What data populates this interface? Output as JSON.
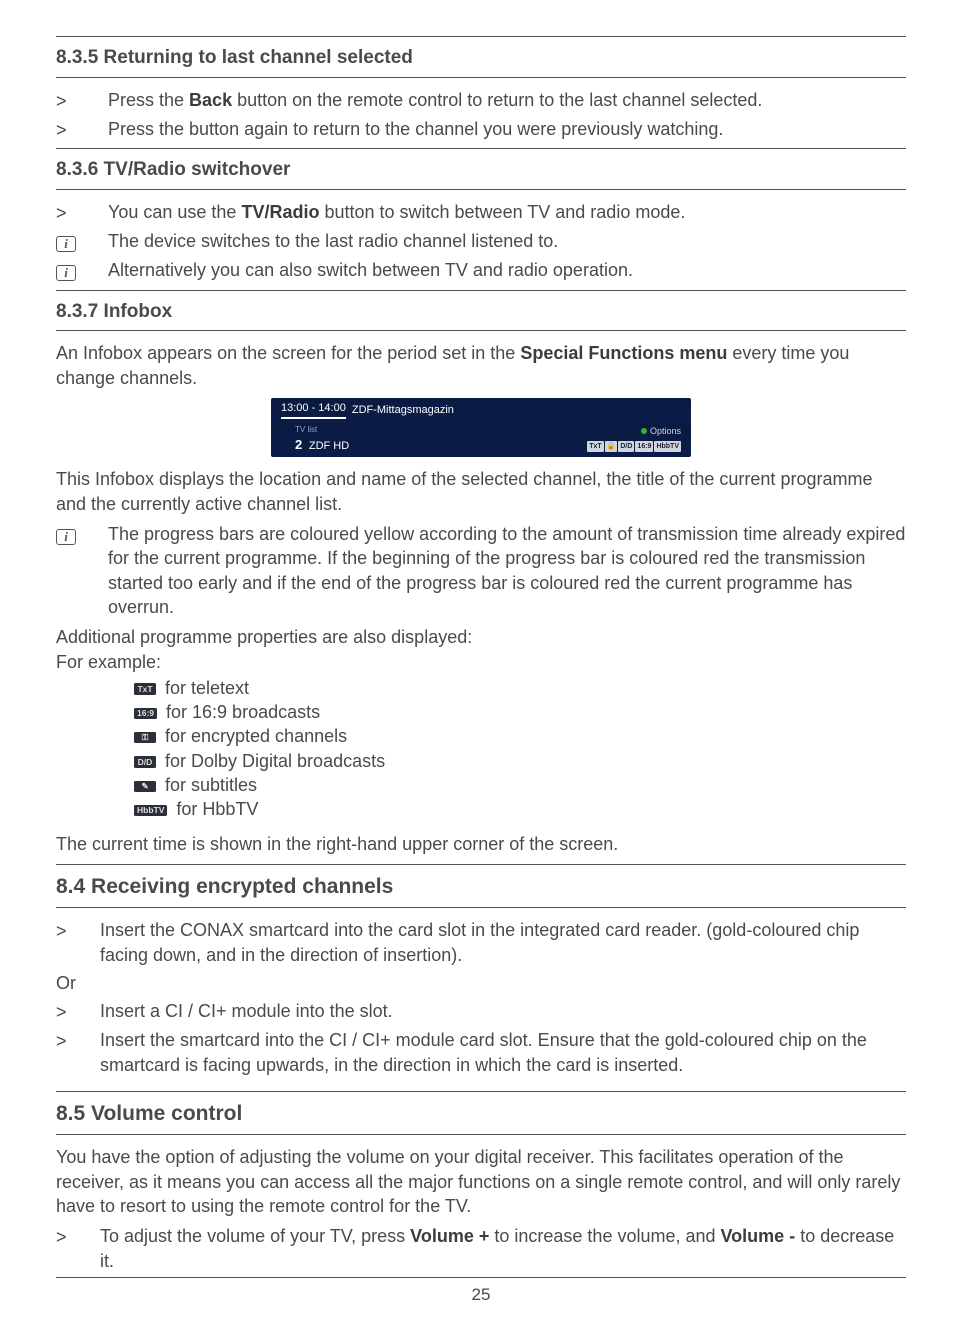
{
  "s835": {
    "heading": "8.3.5 Returning to last channel selected",
    "line1_a": "Press the ",
    "line1_b": " button on the remote control to return to the last channel selected.",
    "back_label": "Back",
    "line2": "Press the button again to return to the channel you were previously watching."
  },
  "s836": {
    "heading": "8.3.6 TV/Radio switchover",
    "line1_a": "You can use the ",
    "line1_b": " button to switch between TV and radio mode.",
    "tvradio_label": "TV/Radio",
    "line2": "The device switches to the last radio channel listened to.",
    "line3": "Alternatively you can also switch between TV and radio operation."
  },
  "s837": {
    "heading": "8.3.7 Infobox",
    "intro_a": "An Infobox appears on the screen for the period set in the ",
    "intro_b": " every time you change channels.",
    "sf_menu_label": "Special Functions menu",
    "img": {
      "time": "13:00 - 14:00",
      "title": "ZDF-Mittagsmagazin",
      "tvlist": "TV list",
      "channel_no": "2",
      "channel_name": "ZDF HD",
      "options": "Options",
      "mini_tags": [
        "TxT",
        "🔒",
        "D/D",
        "16:9",
        "HbbTV"
      ]
    },
    "after_img": "This Infobox displays the location and name of the selected channel, the title of the current programme and the currently active channel list.",
    "info_note": "The progress bars are coloured yellow according to the amount of transmission time already expired for the current programme. If the beginning of the progress bar is coloured red the transmission started too early and if the end of the progress bar is coloured red the current programme has overrun.",
    "add_props": "Additional programme properties are also displayed:",
    "for_example": "For example:",
    "prop_teletext": " for teletext",
    "prop_169": " for 16:9 broadcasts",
    "prop_enc": " for encrypted channels",
    "prop_dd": " for Dolby Digital broadcasts",
    "prop_sub": " for subtitles",
    "prop_hbb": " for HbbTV",
    "tag_txt": "TxT",
    "tag_169": "16:9",
    "tag_key": "⚿",
    "tag_dd": "D/D",
    "tag_sub": "✎",
    "tag_hbb": "HbbTV",
    "time_note": "The current time is shown in the right-hand upper corner of the screen."
  },
  "s84": {
    "heading": "8.4 Receiving encrypted channels",
    "line1": "Insert the CONAX smartcard into the card slot in the integrated card reader. (gold-coloured chip facing down, and in the direction of insertion).",
    "or": "Or",
    "line2": "Insert a CI / CI+ module into the slot.",
    "line3": "Insert the smartcard into the CI / CI+ module card slot. Ensure that the gold-coloured chip on the smartcard is facing upwards, in the direction in which the card is inserted."
  },
  "s85": {
    "heading": "8.5 Volume control",
    "intro": "You have the option of adjusting the volume on your digital receiver. This facilitates operation of the receiver, as it means you can access all the major functions on a single remote control, and will only rarely have to resort to using the remote control for the TV.",
    "line1_a": "To adjust the volume of your TV, press ",
    "line1_b": " to increase the volume, and ",
    "line1_c": " to decrease it.",
    "vol_plus": "Volume +",
    "vol_minus": "Volume -"
  },
  "marker_gt": ">",
  "pagenum": "25"
}
